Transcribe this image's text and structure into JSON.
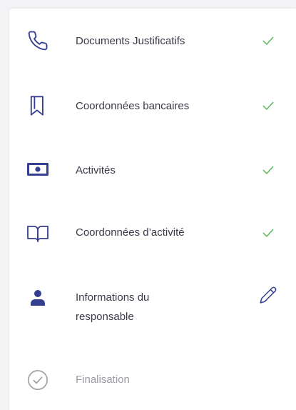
{
  "colors": {
    "icon_primary": "#353f91",
    "check_green": "#5cb85c",
    "edit_icon": "#353f91",
    "text_primary": "#3a3a4a",
    "text_disabled": "#9a9aa4",
    "icon_disabled": "#9a9aa4"
  },
  "steps": [
    {
      "label": "Documents Justificatifs",
      "icon": "phone-icon",
      "status": "check-icon"
    },
    {
      "label": "Coordonnées bancaires",
      "icon": "bookmark-icon",
      "status": "check-icon"
    },
    {
      "label": "Activités",
      "icon": "banknote-icon",
      "status": "check-icon"
    },
    {
      "label": "Coordonnées d’activité",
      "icon": "book-open-icon",
      "status": "check-icon"
    },
    {
      "label_line1": "Informations du",
      "label_line2": "responsable",
      "icon": "user-icon",
      "status": "edit-pencil-icon"
    },
    {
      "label": "Finalisation",
      "icon": "check-circle-icon",
      "status": "none"
    }
  ]
}
